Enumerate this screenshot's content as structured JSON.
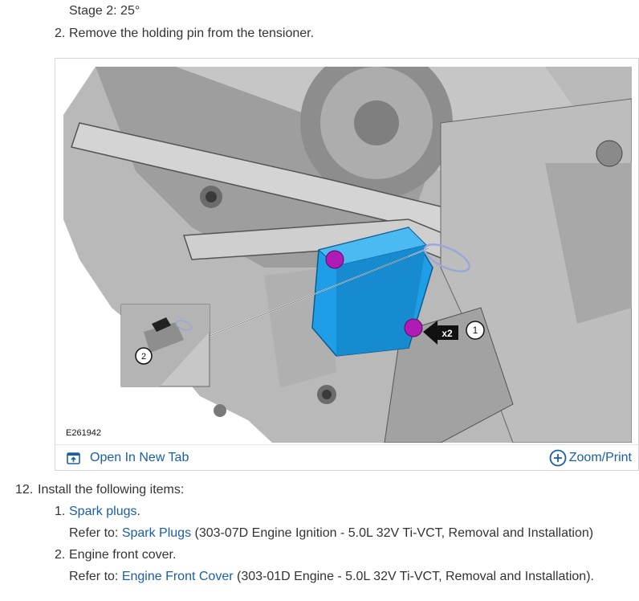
{
  "prev": {
    "stage_line": "Stage 2: 25°",
    "step2_num": "2.",
    "step2_text": "Remove the holding pin from the tensioner."
  },
  "figure": {
    "code": "E261942",
    "callout_qty": "x2",
    "callout_1": "1",
    "callout_2": "2",
    "open_label": "Open In New Tab",
    "zoom_label": "Zoom/Print",
    "icons": [
      "open-new-tab-icon",
      "zoom-plus-icon"
    ],
    "colors": {
      "tensioner": "#1e9ee6",
      "bolt": "#b11bb5",
      "link": "#1a5ea8"
    }
  },
  "step12": {
    "num": "12.",
    "text": "Install the following items:",
    "items": [
      {
        "num": "1.",
        "link": "Spark plugs",
        "suffix": ".",
        "refer_label": "Refer to: ",
        "refer_link": "Spark Plugs",
        "refer_suffix": " (303-07D Engine Ignition - 5.0L 32V Ti-VCT, Removal and Installation)"
      },
      {
        "num": "2.",
        "text": "Engine front cover.",
        "refer_label": "Refer to: ",
        "refer_link": "Engine Front Cover",
        "refer_suffix": " (303-01D Engine - 5.0L 32V Ti-VCT, Removal and Installation)."
      }
    ]
  }
}
